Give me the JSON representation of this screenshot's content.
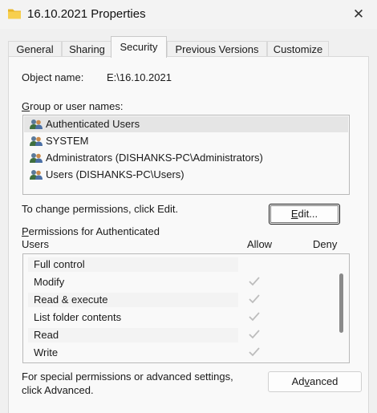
{
  "window": {
    "title": "16.10.2021 Properties",
    "close_glyph": "✕"
  },
  "tabs": [
    {
      "label": "General"
    },
    {
      "label": "Sharing"
    },
    {
      "label": "Security",
      "active": true
    },
    {
      "label": "Previous Versions"
    },
    {
      "label": "Customize"
    }
  ],
  "security": {
    "object_name_label": "Object name:",
    "object_name_value": "E:\\16.10.2021",
    "group_label_first": "G",
    "group_label_rest": "roup or user names:",
    "users": [
      {
        "name": "Authenticated Users",
        "selected": true,
        "icon": "users-group-icon"
      },
      {
        "name": "SYSTEM",
        "selected": false,
        "icon": "users-group-icon"
      },
      {
        "name": "Administrators (DISHANKS-PC\\Administrators)",
        "selected": false,
        "icon": "users-group-icon"
      },
      {
        "name": "Users (DISHANKS-PC\\Users)",
        "selected": false,
        "icon": "users-group-icon"
      }
    ],
    "change_hint": "To change permissions, click Edit.",
    "edit_button_first": "E",
    "edit_button_rest": "dit...",
    "permissions_label_first": "P",
    "permissions_label_rest": "ermissions for Authenticated",
    "permissions_label_line2": "Users",
    "allow_header": "Allow",
    "deny_header": "Deny",
    "permissions": [
      {
        "name": "Full control",
        "allow": false,
        "deny": false
      },
      {
        "name": "Modify",
        "allow": true,
        "deny": false
      },
      {
        "name": "Read & execute",
        "allow": true,
        "deny": false
      },
      {
        "name": "List folder contents",
        "allow": true,
        "deny": false
      },
      {
        "name": "Read",
        "allow": true,
        "deny": false
      },
      {
        "name": "Write",
        "allow": true,
        "deny": false
      }
    ],
    "advanced_hint_line1": "For special permissions or advanced settings,",
    "advanced_hint_line2": "click Advanced.",
    "advanced_button_pre": "Ad",
    "advanced_button_u": "v",
    "advanced_button_post": "anced"
  },
  "colors": {
    "check_disabled": "#bdbdbd",
    "folder_yellow": "#f4c542",
    "selection": "#e5e5e5"
  }
}
